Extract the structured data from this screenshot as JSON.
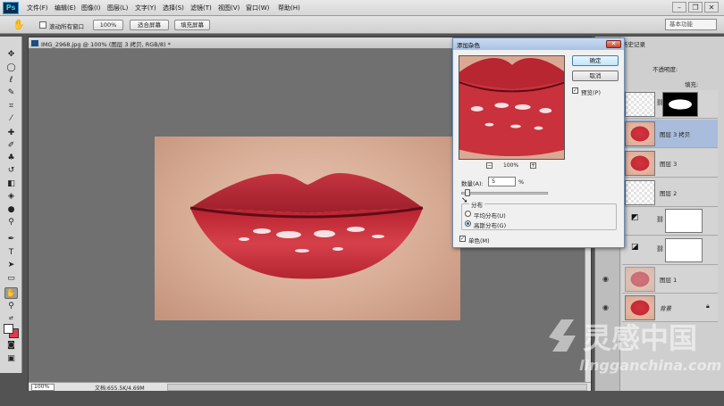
{
  "app": {
    "logo": "Ps",
    "workspace": "基本功能"
  },
  "menu": [
    "文件(F)",
    "编辑(E)",
    "图像(I)",
    "图层(L)",
    "文字(Y)",
    "选择(S)",
    "滤镜(T)",
    "视图(V)",
    "窗口(W)",
    "帮助(H)"
  ],
  "window_controls": {
    "minimize": "–",
    "restore": "❐",
    "close": "✕"
  },
  "options": {
    "scroll_all": "滚动所有窗口",
    "zoom_btn": "100%",
    "fit_screen": "适合屏幕",
    "fill_screen": "填充屏幕"
  },
  "document": {
    "title": "IMG_2968.jpg @ 100% (图层 3 拷贝, RGB/8) *",
    "zoom": "100%",
    "status": "文档:655.5K/4.69M"
  },
  "panels": {
    "history_tab": "历史记录",
    "opacity_label": "不透明度:",
    "fill_label": "填充:",
    "layers": [
      {
        "name": "",
        "kind": "mask"
      },
      {
        "name": "图层 3 拷贝",
        "kind": "lips",
        "selected": true
      },
      {
        "name": "图层 3",
        "kind": "lips"
      },
      {
        "name": "图层 2",
        "kind": "checker"
      },
      {
        "name": "",
        "kind": "adjust"
      },
      {
        "name": "",
        "kind": "adjust"
      },
      {
        "name": "图层 1",
        "kind": "lips-checker"
      },
      {
        "name": "背景",
        "kind": "lips"
      }
    ]
  },
  "dialog": {
    "title": "添加杂色",
    "ok": "确定",
    "cancel": "取消",
    "preview": "预览(P)",
    "zoom": "100%",
    "amount_label": "数量(A):",
    "amount_value": "5",
    "percent": "%",
    "distribution": "分布",
    "uniform": "平均分布(U)",
    "gaussian": "高斯分布(G)",
    "monochromatic": "单色(M)",
    "amount_fraction": 0.05
  },
  "watermark": {
    "brand": "灵感中国",
    "url": "lingganchina.com"
  },
  "colors": {
    "foreground": "#ffffff",
    "background": "#e4394d"
  }
}
